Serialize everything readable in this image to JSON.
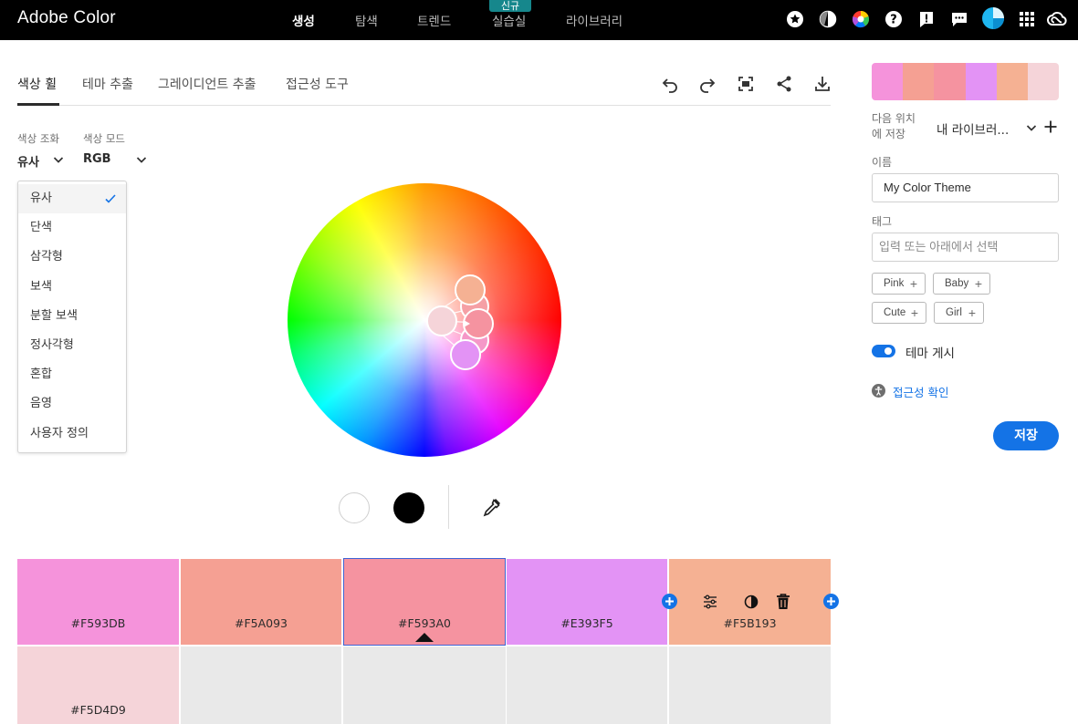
{
  "app": {
    "brand": "Adobe Color"
  },
  "nav": {
    "items": [
      "생성",
      "탐색",
      "트렌드",
      "실습실",
      "라이브러리"
    ],
    "badge": "신규"
  },
  "top_icons": [
    "star-icon",
    "contrast-icon",
    "color-wheel-icon",
    "help-icon",
    "alert-icon",
    "chat-icon",
    "avatar",
    "apps-grid-icon",
    "creative-cloud-icon"
  ],
  "tabs": [
    "색상 휠",
    "테마 추출",
    "그레이디언트 추출",
    "접근성 도구"
  ],
  "toolbar_icons": [
    "undo-icon",
    "redo-icon",
    "fullscreen-icon",
    "share-icon",
    "download-icon"
  ],
  "harmony": {
    "label": "색상 조화",
    "value": "유사"
  },
  "color_mode": {
    "label": "색상 모드",
    "value": "RGB"
  },
  "dropdown": {
    "options": [
      "유사",
      "단색",
      "삼각형",
      "보색",
      "분할 보색",
      "정사각형",
      "혼합",
      "음영",
      "사용자 정의"
    ],
    "selected": "유사"
  },
  "swatches": [
    {
      "hex": "#F593DB"
    },
    {
      "hex": "#F5A093"
    },
    {
      "hex": "#F593A0"
    },
    {
      "hex": "#E393F5"
    },
    {
      "hex": "#F5B193"
    },
    {
      "hex": "#F5D4D9"
    }
  ],
  "right_panel": {
    "save_to_label": "다음 위치\n에 저장",
    "library_value": "내 라이브러...",
    "name_label": "이름",
    "name_value": "My Color Theme",
    "tag_label": "태그",
    "tag_placeholder": "입력 또는 아래에서 선택",
    "tags": [
      "Pink",
      "Baby",
      "Cute",
      "Girl"
    ],
    "publish_label": "테마 게시",
    "publish_on": true,
    "accessibility_link": "접근성 확인",
    "save_button": "저장"
  },
  "colors": {
    "accent": "#1473e6",
    "topbar": "#000000",
    "badge": "#16878c"
  }
}
